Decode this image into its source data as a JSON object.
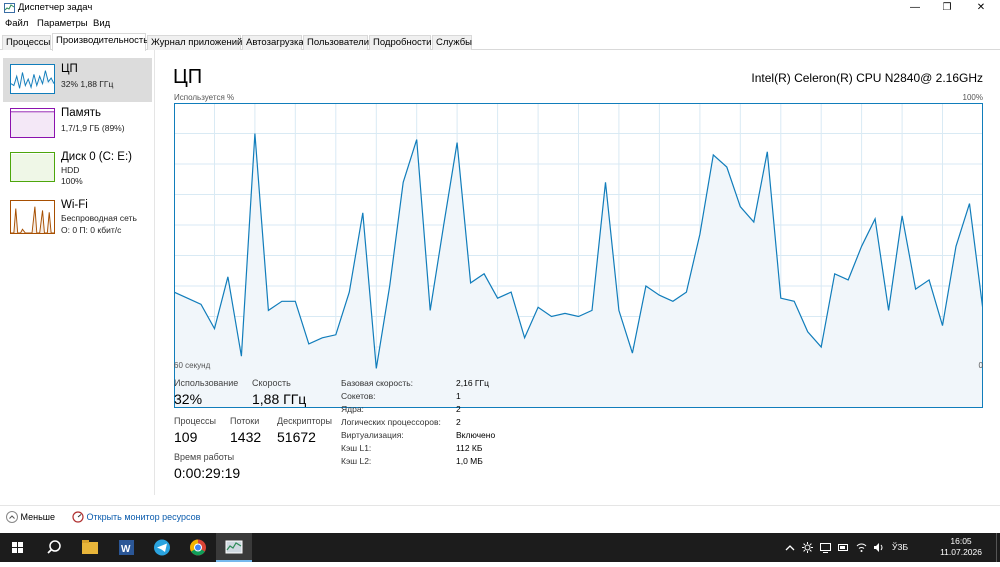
{
  "window": {
    "title": "Диспетчер задач",
    "minimize": "—",
    "maximize": "❐",
    "close": "✕"
  },
  "menu": [
    "Файл",
    "Параметры",
    "Вид"
  ],
  "tabs": [
    "Процессы",
    "Производительность",
    "Журнал приложений",
    "Автозагрузка",
    "Пользователи",
    "Подробности",
    "Службы"
  ],
  "sidebar": {
    "cpu": {
      "title": "ЦП",
      "sub1": "32% 1,88 ГГц"
    },
    "memory": {
      "title": "Память",
      "sub1": "1,7/1,9 ГБ (89%)"
    },
    "disk": {
      "title": "Диск 0 (C: E:)",
      "sub1": "HDD",
      "sub2": "100%"
    },
    "wifi": {
      "title": "Wi-Fi",
      "sub1": "Беспроводная сеть",
      "sub2": "О: 0 П: 0 кбит/с"
    }
  },
  "colors": {
    "cpu": "#117dbb",
    "cpu_fill": "#f1f6fa",
    "memory": "#8b12ae",
    "disk": "#4da60c",
    "wifi": "#a74f01",
    "grid": "#d9eaf4"
  },
  "main": {
    "title": "ЦП",
    "model": "Intel(R) Celeron(R) CPU N2840@ 2.16GHz",
    "usage_label": "Используется %",
    "max_label": "100%",
    "time_label": "60 секунд",
    "min_label": "0"
  },
  "chart_data": {
    "type": "line",
    "title": "",
    "xlabel": "60 секунд",
    "ylabel": "Используется %",
    "ylim": [
      0,
      100
    ],
    "series": [
      {
        "values": [
          38,
          36,
          34,
          26,
          43,
          17,
          90,
          32,
          35,
          35,
          21,
          23,
          24,
          38,
          64,
          13,
          40,
          74,
          88,
          32,
          60,
          87,
          41,
          44,
          36,
          38,
          23,
          33,
          30,
          31,
          30,
          32,
          74,
          32,
          18,
          40,
          37,
          35,
          38,
          57,
          83,
          79,
          66,
          61,
          84,
          36,
          35,
          25,
          20,
          44,
          42,
          53,
          62,
          32,
          63,
          39,
          42,
          27,
          53,
          67,
          32
        ]
      }
    ]
  },
  "stats": {
    "usage_label": "Использование",
    "usage_value": "32%",
    "speed_label": "Скорость",
    "speed_value": "1,88 ГГц",
    "processes_label": "Процессы",
    "processes_value": "109",
    "threads_label": "Потоки",
    "threads_value": "1432",
    "handles_label": "Дескрипторы",
    "handles_value": "51672",
    "uptime_label": "Время работы",
    "uptime_value": "0:00:29:19"
  },
  "info": [
    {
      "label": "Базовая скорость:",
      "value": "2,16 ГГц"
    },
    {
      "label": "Сокетов:",
      "value": "1"
    },
    {
      "label": "Ядра:",
      "value": "2"
    },
    {
      "label": "Логических процессоров:",
      "value": "2"
    },
    {
      "label": "Виртуализация:",
      "value": "Включено"
    },
    {
      "label": "Кэш L1:",
      "value": "112 КБ"
    },
    {
      "label": "Кэш L2:",
      "value": "1,0 МБ"
    }
  ],
  "footer": {
    "less": "Меньше",
    "monitor": "Открыть монитор ресурсов"
  },
  "taskbar": {
    "icons": [
      "windows-start-icon",
      "search-icon",
      "file-explorer-icon",
      "word-icon",
      "telegram-icon",
      "chrome-icon",
      "task-manager-icon"
    ],
    "lang": "ЎЗБ",
    "time": "16:05",
    "date": "11.07.2026"
  }
}
